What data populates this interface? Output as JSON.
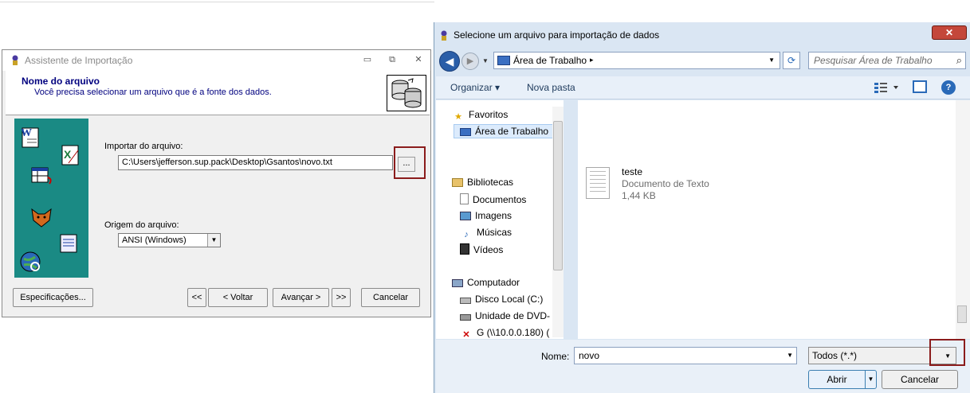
{
  "wizard": {
    "title": "Assistente de Importação",
    "min_glyph": "▭",
    "max_glyph": "⧉",
    "close_glyph": "✕",
    "header_title": "Nome do arquivo",
    "header_subtitle": "Você precisa selecionar um arquivo que é a fonte dos dados.",
    "import_label": "Importar do arquivo:",
    "import_path": "C:\\Users\\jefferson.sup.pack\\Desktop\\Gsantos\\novo.txt",
    "browse_label": "...",
    "origin_label": "Origem do arquivo:",
    "origin_value": "ANSI (Windows)",
    "buttons": {
      "specs": "Especificações...",
      "first": "<<",
      "back": "< Voltar",
      "next": "Avançar >",
      "last": ">>",
      "cancel": "Cancelar"
    },
    "teal_color": "#1a8a84",
    "highlight_color": "#8b1c1c"
  },
  "dialog": {
    "title": "Selecione um arquivo para importação de dados",
    "close_glyph": "✕",
    "address": "Área de Trabalho",
    "address_sep": "▸",
    "search_placeholder": "Pesquisar Área de Trabalho",
    "toolbar": {
      "organize": "Organizar ▾",
      "new_folder": "Nova pasta",
      "help": "?"
    },
    "nav": {
      "favorites": "Favoritos",
      "desktop": "Área de Trabalho",
      "libraries": "Bibliotecas",
      "documents": "Documentos",
      "images": "Imagens",
      "music": "Músicas",
      "videos": "Vídeos",
      "computer": "Computador",
      "local_disk": "Disco Local (C:)",
      "dvd": "Unidade de DVD-",
      "network": "G (\\\\10.0.0.180) ("
    },
    "file": {
      "name": "teste",
      "type": "Documento de Texto",
      "size": "1,44 KB"
    },
    "name_label": "Nome:",
    "name_value": "novo",
    "filter_value": "Todos (*.*)",
    "open_label": "Abrir",
    "cancel_label": "Cancelar"
  }
}
